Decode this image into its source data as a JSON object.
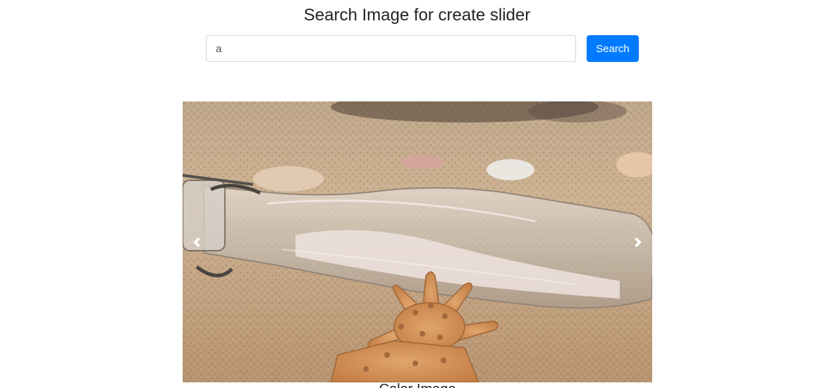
{
  "header": {
    "title": "Search Image for create slider"
  },
  "search": {
    "value": "a",
    "button_label": "Search"
  },
  "slider": {
    "image_alt": "Message in a bottle with a starfish on sand",
    "prev_icon": "chevron-left-icon",
    "next_icon": "chevron-right-icon",
    "caption": "Color Image"
  },
  "colors": {
    "primary": "#007bff",
    "text": "#212529",
    "input_border": "#ced4da"
  }
}
